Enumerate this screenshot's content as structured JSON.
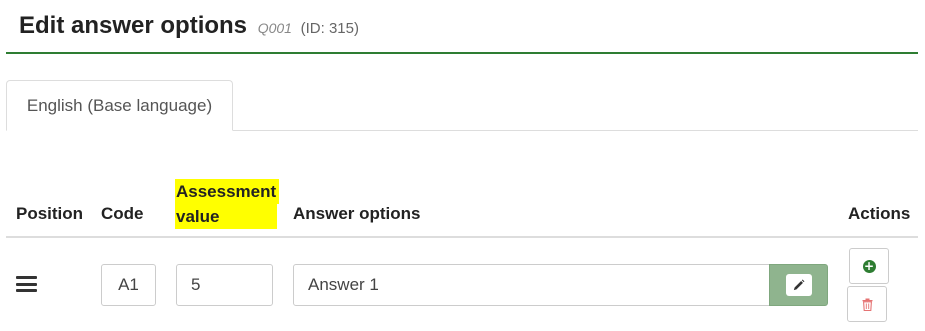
{
  "header": {
    "title": "Edit answer options",
    "question_code": "Q001",
    "question_id": "(ID: 315)"
  },
  "tabs": [
    {
      "label": "English (Base language)",
      "active": true
    }
  ],
  "table": {
    "columns": {
      "position": "Position",
      "code": "Code",
      "assessment_line1": "Assessment",
      "assessment_line2": "value",
      "answer_options": "Answer options",
      "actions": "Actions"
    },
    "rows": [
      {
        "code": "A1",
        "assessment_value": "5",
        "answer": "Answer 1"
      }
    ]
  },
  "icons": {
    "drag": "drag-handle-icon",
    "edit": "pencil-icon",
    "add": "plus-circle-icon",
    "delete": "trash-icon"
  },
  "colors": {
    "accent_green": "#2e7d32",
    "highlight": "#ffff00",
    "edit_button": "#8fb48e",
    "delete_icon": "#e57373"
  }
}
